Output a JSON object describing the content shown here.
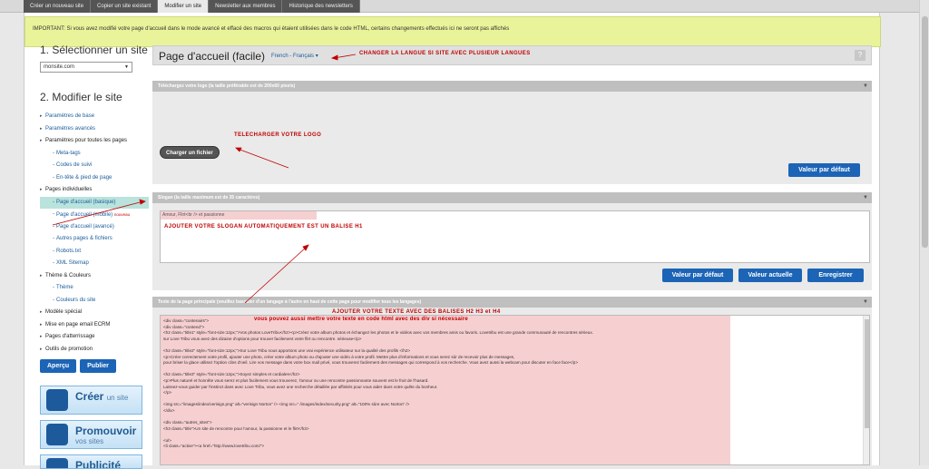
{
  "topnav": {
    "tabs": [
      "Créer un nouveau site",
      "Copier un site existant",
      "Modifier un site",
      "Newsletter aux membres",
      "Historique des newsletters"
    ],
    "active": "Modifier un site"
  },
  "notice": "IMPORTANT: Si vous avez modifié votre page d'accueil dans le mode avancé et effacé des macros qui étaient utilisées dans le code HTML, certains changements effectués ici ne seront pas affichés",
  "sidebar": {
    "step1": "1. Sélectionner un site",
    "site_select": "monsite.com",
    "step2": "2. Modifier le site",
    "menu": {
      "base": "Paramètres de base",
      "advanced": "Paramètres avancés",
      "all_pages": "Paramètres pour toutes les pages",
      "meta": "Meta-tags",
      "tracking": "Codes de suivi",
      "header": "En-tête & pied de page",
      "pages": "Pages individuelles",
      "home_basic": "Page d'accueil (basique)",
      "home_mobile": "Page d'accueil (mobile)",
      "home_adv": "Page d'accueil (avancé)",
      "other": "Autres pages & fichiers",
      "robots": "Robots.txt",
      "sitemap": "XML Sitemap",
      "theme": "Thème & Couleurs",
      "theme_sub": "Thème",
      "colors": "Couleurs du site",
      "special": "Modèle spécial",
      "ecrm": "Mise en page email ECRM",
      "landing": "Pages d'atterrissage",
      "promo_tools": "Outils de promotion"
    },
    "badge": "nouveau",
    "preview_btn": "Aperçu",
    "publish_btn": "Publier",
    "promo1_title": "Créer",
    "promo1_small": "un site",
    "promo2_title": "Promouvoir",
    "promo2_sub": "vos sites",
    "promo3_title": "Publicité"
  },
  "main": {
    "title": "Page d'accueil (facile)",
    "lang": "French - Français",
    "help": "?",
    "logo_head": "Téléchargez votre logo (la taille préférable est de 200x60 pixels)",
    "upload_btn": "Charger un fichier",
    "default_btn": "Valeur par défaut",
    "slogan_head": "Slogan (la taille maximum est de 35 caractères)",
    "slogan_value": "Amour, Flirt<br /> et passionne",
    "slogan_default": "Valeur par défaut",
    "slogan_current": "Valeur actuelle",
    "slogan_save": "Enregistrer",
    "text_head": "Texte de la page principale (veuillez basculer d'un langage à l'autre en haut de cette page pour modifier tous les langages)",
    "code_lines": [
      "<div class=\"contenairs\">",
      "<div class=\"contend\">",
      "<h2 class=\"title1\" style=\"font-size:12px;\">Vos photos LoveTribu</h2><p>Créez votre album photos et échangez les photos et le vidéos avec vos membres amis ou favoris. Lovetribu est une grande communauté de rencontres sérieux.",
      "sur Love Tribu vous avez des dizaine d'options pour trouver facilement votre flirt ou rencontre. sérieuse</p>",
      "",
      "<h2 class=\"title2\" style=\"font-size:12px;\">Sur Love Tribu nous apportons une vrai expérience utilisateur sur la qualité des profils </h2>",
      "<p>Créer correctement votre profil, ajouter une photo, créer votre album photo ou d'ajouter une vidéo à votre profil. Mettre plus d'informations et vous serez sûr de recevoir plus de messages,",
      "pour briser la glace utilisez l'option clins d'oeil. Lire vos message dans votre box mail privé, vous trouverez facilement des messages qui correspond à vos recherche. Vous avez aussi la webcam pour discuter en face face</p>",
      "",
      "<h2 class=\"title3\" style=\"font-size:12px;\">Soyez simples et cordiales</h2>",
      " <p>Plus naturel et honnête vous serez et plus facilement vous trouverez, l'amour ou une rencontre passionnante souvent est le fruit de l'hasard.",
      "Laissez-vous guider par l'instinct dans avec Love Tribu, vous avez une recherche détaillée par affinités pour vous aider dans votre quête du bonheur.",
      "</p>",
      "",
      "<img src=\"/images/index/verisign.png\" alt=\"verisign Norton\" />  <img src=\" /images/index/security.png\" alt=\"100% sûre avec Norton\" />",
      "</div>",
      "",
      "<div class=\"autres_sites\">",
      "<h3 class=\"title\">Un site de rencontre pour l'amour, la passionne et le flirt</h3>",
      "",
      "<ul>",
      "<li class=\"active\"><a href=\"http://www.lovetribu.com/\">"
    ]
  },
  "annotations": {
    "lang": "CHANGER LA LANGUE SI SITE AVEC PLUSIEUR LANGUES",
    "logo": "TELECHARGER VOTRE LOGO",
    "slogan": "AJOUTER VOTRE SLOGAN AUTOMATIQUEMENT EST UN BALISE H1",
    "text1": "AJOUTER VOTRE TEXTE AVEC DES BALISES H2 H3 et H4",
    "text2": "vous pouvez aussi mettre votre texte en code html avec des div si nécessaire"
  }
}
